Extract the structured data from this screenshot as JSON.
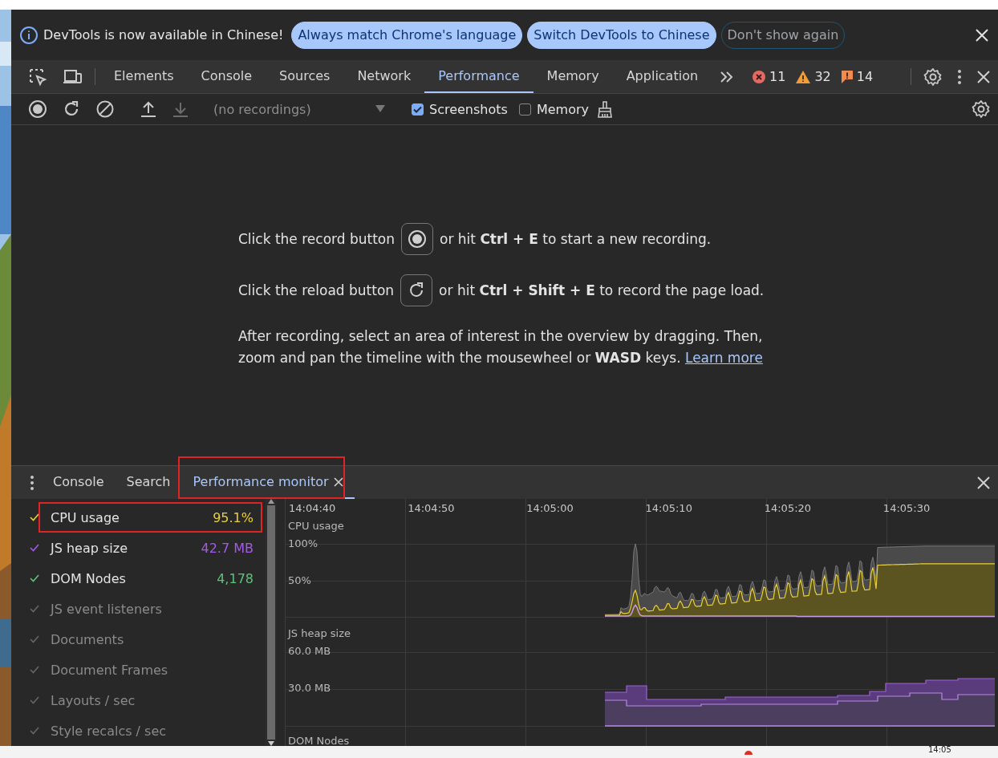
{
  "infobar": {
    "message": "DevTools is now available in Chinese!",
    "buttons": [
      {
        "label": "Always match Chrome's language",
        "kind": "primary"
      },
      {
        "label": "Switch DevTools to Chinese",
        "kind": "primary"
      },
      {
        "label": "Don't show again",
        "kind": "outline"
      }
    ]
  },
  "main_tabs": [
    {
      "label": "Elements",
      "selected": false
    },
    {
      "label": "Console",
      "selected": false
    },
    {
      "label": "Sources",
      "selected": false
    },
    {
      "label": "Network",
      "selected": false
    },
    {
      "label": "Performance",
      "selected": true
    },
    {
      "label": "Memory",
      "selected": false
    },
    {
      "label": "Application",
      "selected": false
    }
  ],
  "counts": {
    "errors": "11",
    "warnings": "32",
    "issues": "14"
  },
  "perf_toolbar": {
    "recordings": "(no recordings)",
    "options": [
      {
        "label": "Screenshots",
        "checked": true
      },
      {
        "label": "Memory",
        "checked": false
      }
    ]
  },
  "landing": {
    "record": {
      "before": "Click the record button",
      "after": "or hit **Ctrl + E** to start a new recording."
    },
    "reload": {
      "before": "Click the reload button",
      "after": "or hit **Ctrl + Shift + E** to record the page load."
    },
    "help": {
      "text": "After recording, select an area of interest in the overview by dragging. Then, zoom and pan the timeline with the mousewheel or **WASD** keys.",
      "link": "Learn more"
    }
  },
  "drawer_tabs": [
    {
      "label": "Console",
      "selected": false,
      "highlighted": false,
      "closable": false
    },
    {
      "label": "Search",
      "selected": false,
      "highlighted": false,
      "closable": false
    },
    {
      "label": "Performance monitor",
      "selected": true,
      "highlighted": true,
      "closable": true
    }
  ],
  "metrics": [
    {
      "label": "CPU usage",
      "value": "95.1%",
      "checked": true,
      "color": "#e8cf3c",
      "highlighted": true
    },
    {
      "label": "JS heap size",
      "value": "42.7 MB",
      "checked": true,
      "color": "#a35be6",
      "highlighted": false
    },
    {
      "label": "DOM Nodes",
      "value": "4,178",
      "checked": true,
      "color": "#5ec37a",
      "highlighted": false
    },
    {
      "label": "JS event listeners",
      "checked": false,
      "highlighted": false
    },
    {
      "label": "Documents",
      "checked": false,
      "highlighted": false
    },
    {
      "label": "Document Frames",
      "checked": false,
      "highlighted": false
    },
    {
      "label": "Layouts / sec",
      "checked": false,
      "highlighted": false
    },
    {
      "label": "Style recalcs / sec",
      "checked": false,
      "highlighted": false
    }
  ],
  "monitor": {
    "times": [
      "14:04:40",
      "14:04:50",
      "14:05:00",
      "14:05:10",
      "14:05:20",
      "14:05:30"
    ],
    "sections": [
      {
        "title": "CPU usage",
        "ticks": [
          "100%",
          "50%"
        ]
      },
      {
        "title": "JS heap size",
        "ticks": [
          "60.0 MB",
          "30.0 MB"
        ]
      },
      {
        "title": "DOM Nodes"
      }
    ]
  },
  "taskbar": {
    "clock": "14:05"
  }
}
